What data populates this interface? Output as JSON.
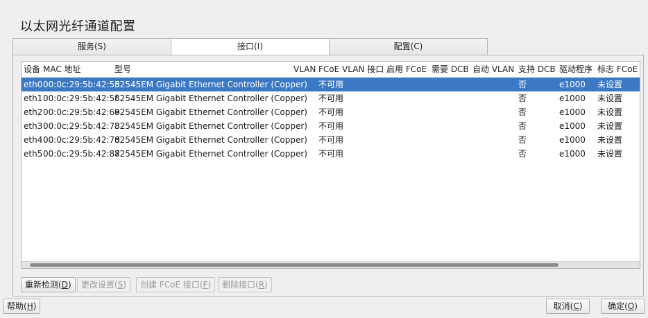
{
  "window": {
    "title": "以太网光纤通道配置"
  },
  "tabs": [
    {
      "label": "服务(S)"
    },
    {
      "label": "接口(I)"
    },
    {
      "label": "配置(C)"
    }
  ],
  "table": {
    "columns": [
      "设备",
      "MAC 地址",
      "型号",
      "VLAN",
      "FCoE VLAN 接口",
      "启用 FCoE",
      "需要 DCB",
      "自动 VLAN",
      "支持 DCB",
      "驱动程序",
      "标志 FCoE"
    ],
    "rows": [
      [
        "eth0",
        "00:0c:29:5b:42:55",
        "82545EM Gigabit Ethernet Controller (Copper)",
        "",
        "不可用",
        "",
        "",
        "",
        "否",
        "e1000",
        "未设置"
      ],
      [
        "eth1",
        "00:0c:29:5b:42:5f",
        "82545EM Gigabit Ethernet Controller (Copper)",
        "",
        "不可用",
        "",
        "",
        "",
        "否",
        "e1000",
        "未设置"
      ],
      [
        "eth2",
        "00:0c:29:5b:42:69",
        "82545EM Gigabit Ethernet Controller (Copper)",
        "",
        "不可用",
        "",
        "",
        "",
        "否",
        "e1000",
        "未设置"
      ],
      [
        "eth3",
        "00:0c:29:5b:42:73",
        "82545EM Gigabit Ethernet Controller (Copper)",
        "",
        "不可用",
        "",
        "",
        "",
        "否",
        "e1000",
        "未设置"
      ],
      [
        "eth4",
        "00:0c:29:5b:42:7d",
        "82545EM Gigabit Ethernet Controller (Copper)",
        "",
        "不可用",
        "",
        "",
        "",
        "否",
        "e1000",
        "未设置"
      ],
      [
        "eth5",
        "00:0c:29:5b:42:87",
        "82545EM Gigabit Ethernet Controller (Copper)",
        "",
        "不可用",
        "",
        "",
        "",
        "否",
        "e1000",
        "未设置"
      ]
    ],
    "selected_row": 0
  },
  "actions": {
    "retest": {
      "text": "重新检测",
      "key": "D"
    },
    "change_settings": {
      "text": "更改设置",
      "key": "S"
    },
    "create_fcoe": {
      "text": "创建 FCoE 接口",
      "key": "F"
    },
    "delete_interface": {
      "text": "删除接口",
      "key": "R"
    }
  },
  "footer": {
    "help": {
      "text": "帮助",
      "key": "H"
    },
    "cancel": {
      "text": "取消",
      "key": "C"
    },
    "ok": {
      "text": "确定",
      "key": "O"
    }
  },
  "colors": {
    "selection": "#3c79c4",
    "window_bg": "#efefef"
  }
}
